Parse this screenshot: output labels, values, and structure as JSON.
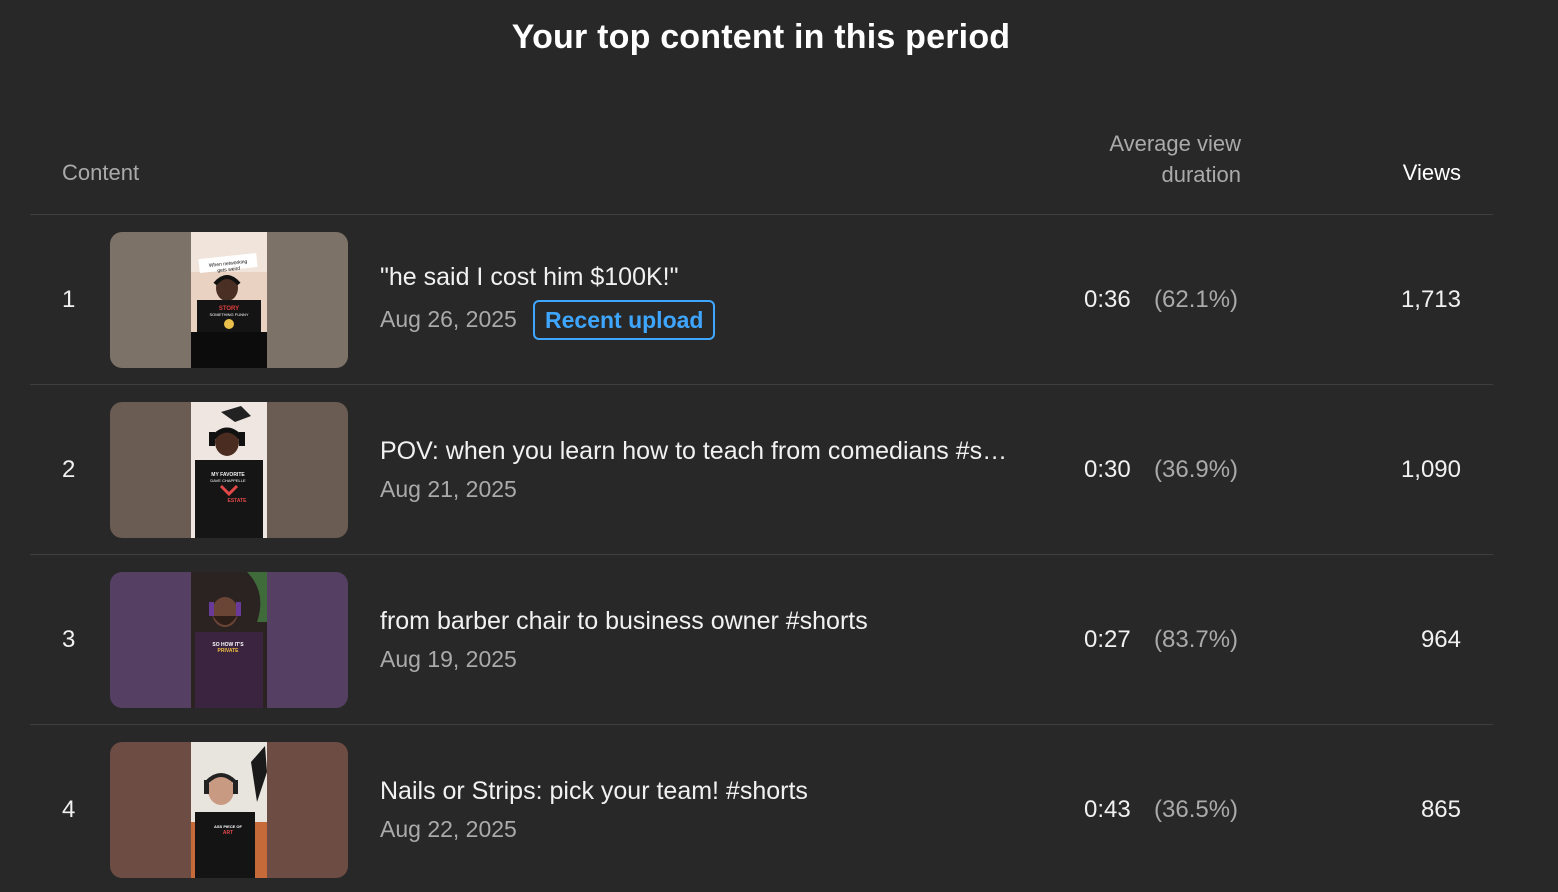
{
  "page": {
    "title": "Your top content in this period"
  },
  "table": {
    "headers": {
      "content": "Content",
      "avd_line1": "Average view",
      "avd_line2": "duration",
      "views": "Views"
    },
    "rows": [
      {
        "rank": "1",
        "title": "\"he said I cost him $100K!\"",
        "date": "Aug 26, 2025",
        "badge": "Recent upload",
        "duration": "0:36",
        "percent": "(62.1%)",
        "views": "1,713",
        "thumb_text": [
          "When networking",
          "gets weird",
          "STORY",
          "SOMETHING FUNNY"
        ],
        "thumb_color": "#7d7268"
      },
      {
        "rank": "2",
        "title": "POV: when you learn how to teach from comedians #s…",
        "date": "Aug 21, 2025",
        "duration": "0:30",
        "percent": "(36.9%)",
        "views": "1,090",
        "thumb_text": [
          "MY FAVORITE",
          "DAVE CHAPPELLE",
          "ESTATE"
        ],
        "thumb_color": "#6a5b53"
      },
      {
        "rank": "3",
        "title": "from barber chair to business owner #shorts",
        "date": "Aug 19, 2025",
        "duration": "0:27",
        "percent": "(83.7%)",
        "views": "964",
        "thumb_text": [
          "SO HOW IT'S",
          "PRIVATE"
        ],
        "thumb_color": "#553f63"
      },
      {
        "rank": "4",
        "title": "Nails or Strips: pick your team! #shorts",
        "date": "Aug 22, 2025",
        "duration": "0:43",
        "percent": "(36.5%)",
        "views": "865",
        "thumb_text": [
          "ASS PIECE OF",
          "ART"
        ],
        "thumb_color": "#6d4d43"
      }
    ]
  },
  "colors": {
    "background": "#282828",
    "divider": "#3f3f3f",
    "badge": "#3ea6ff",
    "muted_text": "#aaaaaa"
  }
}
